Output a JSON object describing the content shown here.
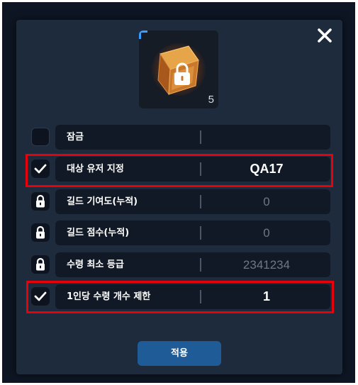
{
  "dialog": {
    "close_icon": "close-icon",
    "item": {
      "icon": "locked-box-icon",
      "count": "5"
    },
    "rows": [
      {
        "label": "잠금",
        "value": "",
        "state": "unchecked",
        "highlighted": false
      },
      {
        "label": "대상 유저 지정",
        "value": "QA17",
        "state": "checked",
        "highlighted": true
      },
      {
        "label": "길드 기여도(누적)",
        "value": "0",
        "state": "locked",
        "highlighted": false
      },
      {
        "label": "길드 점수(누적)",
        "value": "0",
        "state": "locked",
        "highlighted": false
      },
      {
        "label": "수령 최소 등급",
        "value": "2341234",
        "state": "locked",
        "highlighted": false
      },
      {
        "label": "1인당 수령 개수 제한",
        "value": "1",
        "state": "checked",
        "highlighted": true
      }
    ],
    "apply_label": "적용"
  },
  "colors": {
    "panel": "#1e2b3c",
    "row_bg": "#111926",
    "highlight": "#e8000b",
    "apply_button": "#1e5b97",
    "accent_corner": "#3a9dff"
  }
}
